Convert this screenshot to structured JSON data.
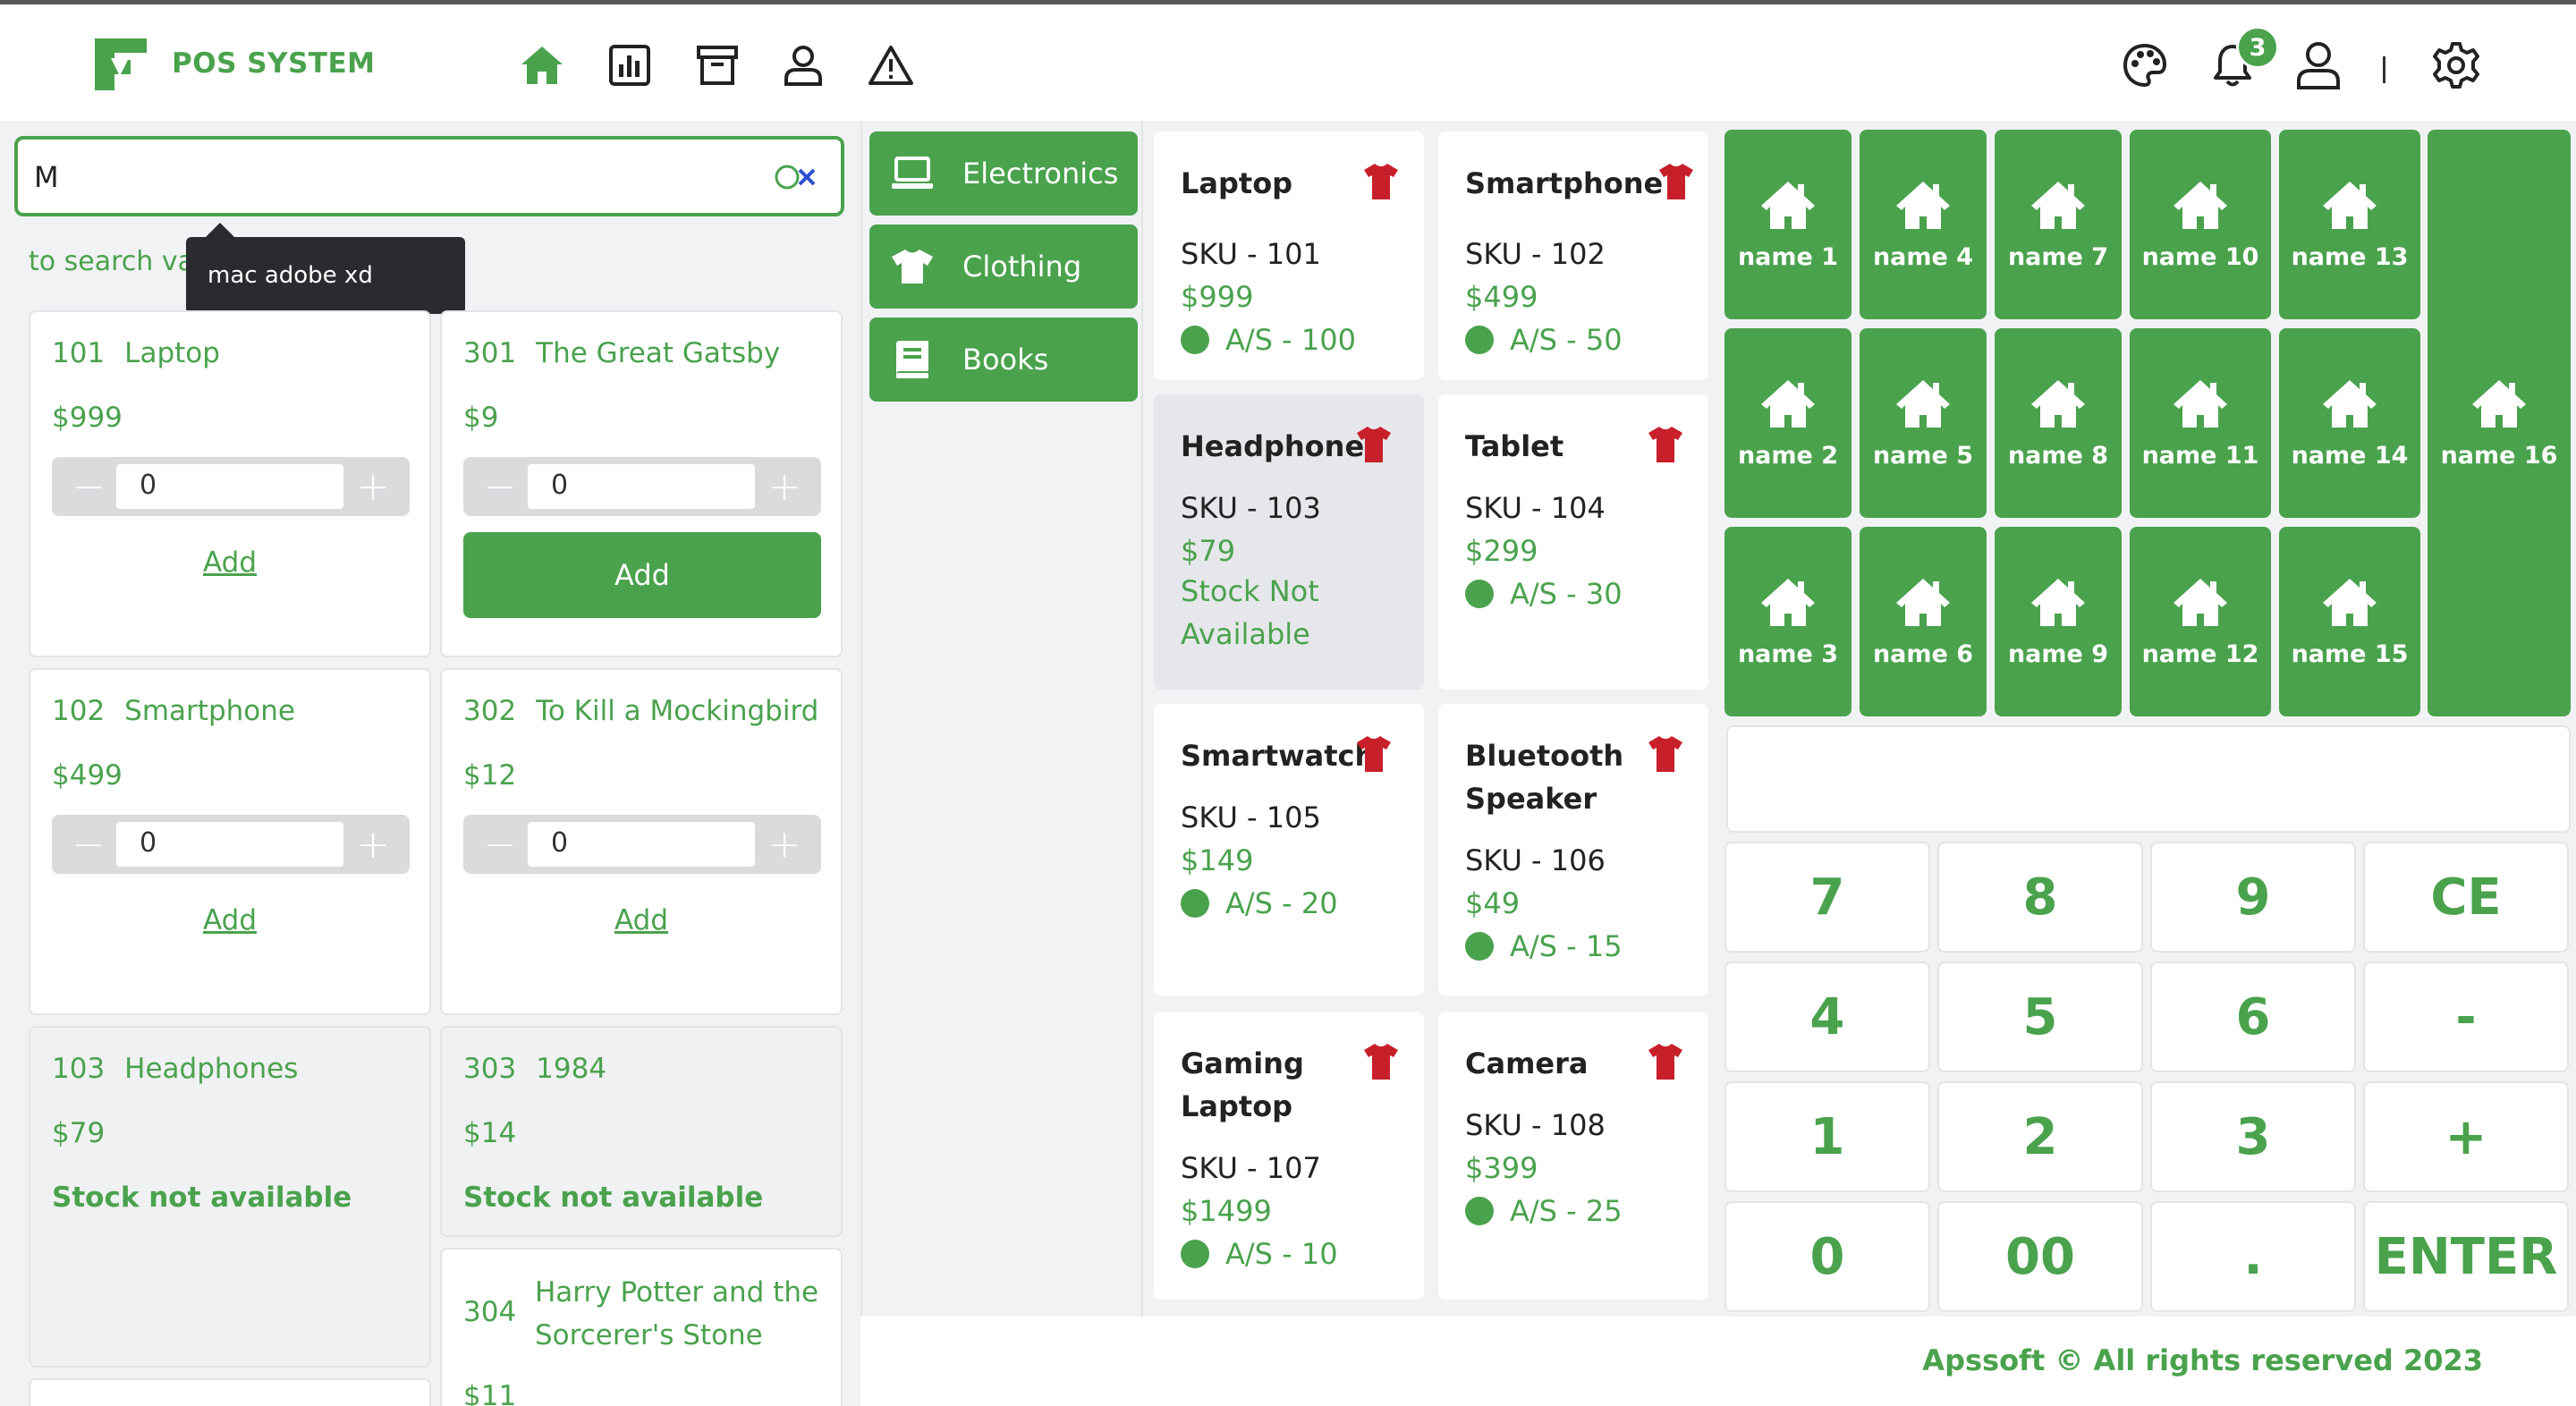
{
  "header": {
    "brand": "POS SYSTEM",
    "nav_icons": [
      "home-icon",
      "chart-icon",
      "archive-icon",
      "user-icon",
      "warning-icon"
    ],
    "right_icons": [
      "palette-icon",
      "bell-icon",
      "account-icon",
      "gear-icon"
    ],
    "notification_count": "3"
  },
  "search": {
    "value": "M",
    "hint": "to search va",
    "tooltip": "mac adobe xd"
  },
  "search_results": [
    {
      "id": "101",
      "name": "Laptop",
      "price": "$999",
      "qty": "0",
      "add": "Add",
      "state": "link"
    },
    {
      "id": "301",
      "name": "The Great Gatsby",
      "price": "$9",
      "qty": "0",
      "add": "Add",
      "state": "button"
    },
    {
      "id": "102",
      "name": "Smartphone",
      "price": "$499",
      "qty": "0",
      "add": "Add",
      "state": "link"
    },
    {
      "id": "302",
      "name": "To Kill a Mockingbird",
      "price": "$12",
      "qty": "0",
      "add": "Add",
      "state": "link"
    },
    {
      "id": "103",
      "name": "Headphones",
      "price": "$79",
      "stock_message": "Stock not available"
    },
    {
      "id": "303",
      "name": "1984",
      "price": "$14",
      "stock_message": "Stock not available"
    },
    {
      "id": "304",
      "name_line1": "Harry Potter and the",
      "name_line2": "Sorcerer's Stone",
      "price": "$11"
    }
  ],
  "categories": [
    {
      "label": "Electronics",
      "icon": "laptop-icon"
    },
    {
      "label": "Clothing",
      "icon": "shirt-icon"
    },
    {
      "label": "Books",
      "icon": "book-icon"
    }
  ],
  "products": [
    {
      "name": "Laptop",
      "sku": "SKU - 101",
      "price": "$999",
      "avail": "A/S - 100"
    },
    {
      "name": "Smartphone",
      "sku": "SKU - 102",
      "price": "$499",
      "avail": "A/S - 50"
    },
    {
      "name": "Headphones",
      "sku": "SKU - 103",
      "price": "$79",
      "stock_line1": "Stock Not",
      "stock_line2": "Available"
    },
    {
      "name": "Tablet",
      "sku": "SKU - 104",
      "price": "$299",
      "avail": "A/S - 30"
    },
    {
      "name": "Smartwatch",
      "sku": "SKU - 105",
      "price": "$149",
      "avail": "A/S - 20"
    },
    {
      "name_line1": "Bluetooth",
      "name_line2": "Speaker",
      "sku": "SKU - 106",
      "price": "$49",
      "avail": "A/S - 15"
    },
    {
      "name_line1": "Gaming",
      "name_line2": "Laptop",
      "sku": "SKU - 107",
      "price": "$1499",
      "avail": "A/S - 10"
    },
    {
      "name": "Camera",
      "sku": "SKU - 108",
      "price": "$399",
      "avail": "A/S - 25"
    }
  ],
  "quick_tiles": [
    "name 1",
    "name 4",
    "name 7",
    "name 10",
    "name 13",
    "name 2",
    "name 5",
    "name 8",
    "name 11",
    "name 14",
    "name 3",
    "name 6",
    "name 9",
    "name 12",
    "name 15",
    "name 16"
  ],
  "keypad": [
    "7",
    "8",
    "9",
    "CE",
    "4",
    "5",
    "6",
    "-",
    "1",
    "2",
    "3",
    "+",
    "0",
    "00",
    ".",
    "ENTER"
  ],
  "footer": "Apssoft © All rights reserved 2023",
  "colors": {
    "accent": "#4aa24d",
    "shirt": "#c8202a",
    "background": "#f1f2f4"
  }
}
